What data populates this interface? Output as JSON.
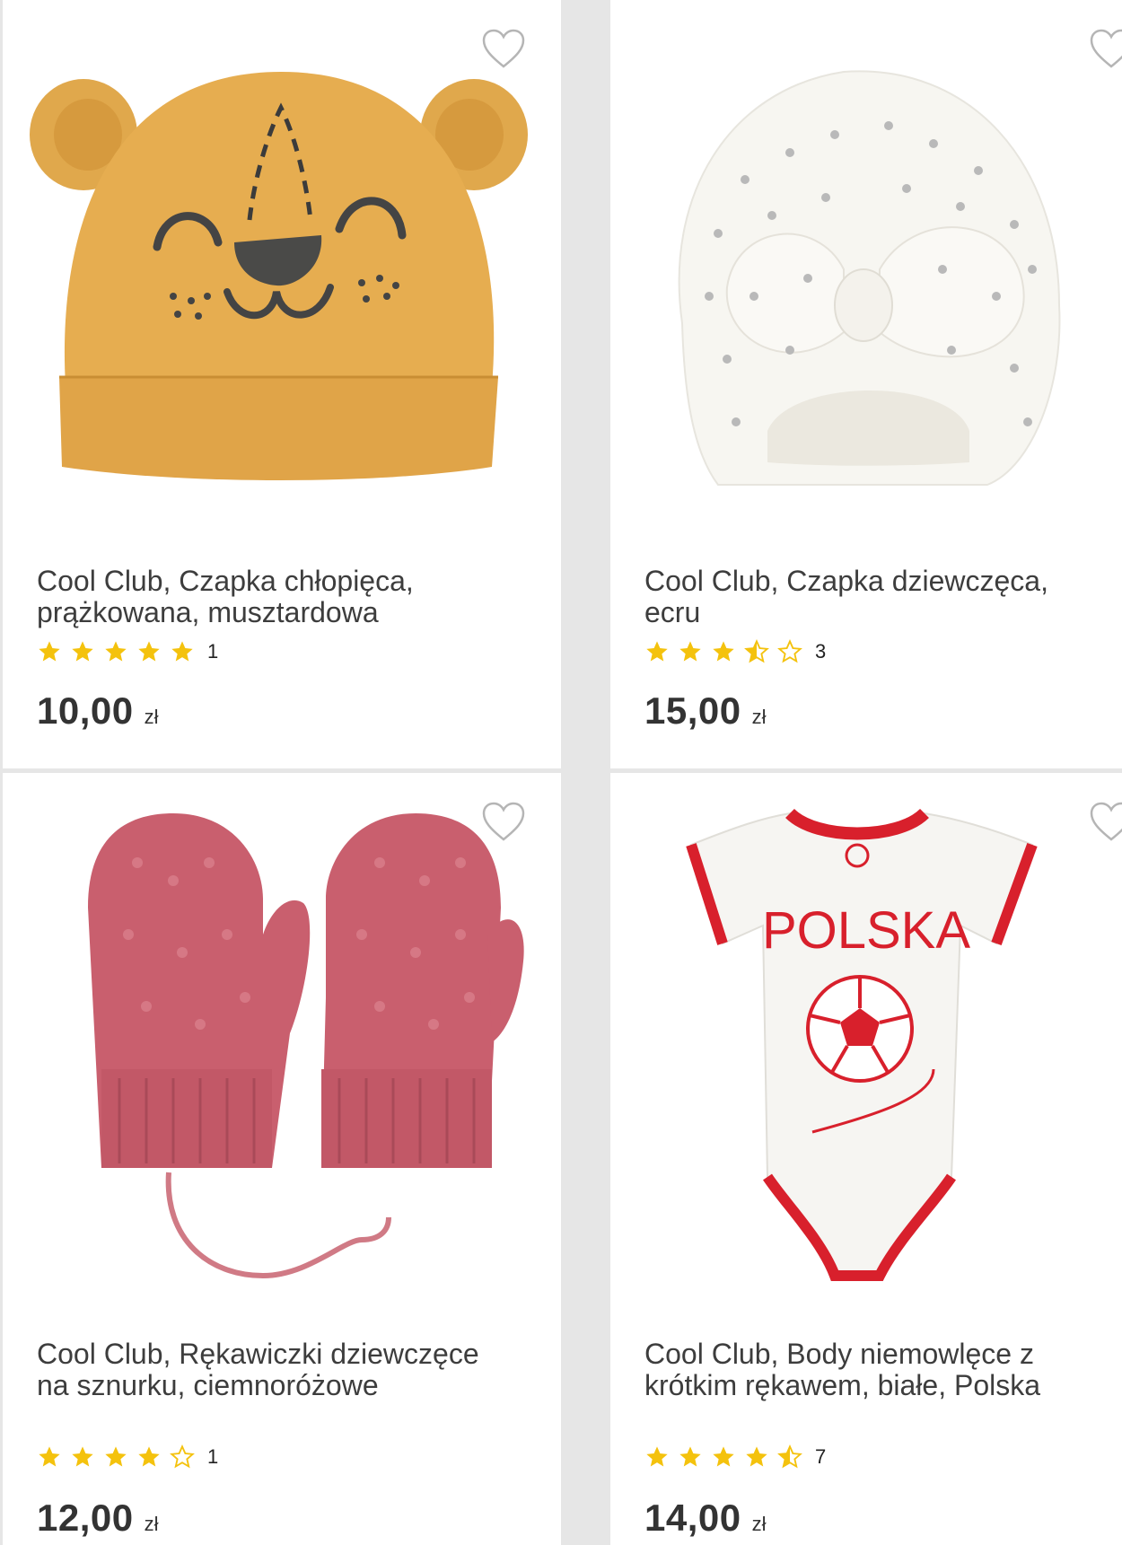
{
  "products": [
    {
      "title_line1": "Cool Club, Czapka chłopięca,",
      "title_line2": "prążkowana, musztardowa",
      "rating": 5,
      "rating_count": "1",
      "price": "10,00",
      "currency": "zł",
      "image_icon": "mustard-bear-hat-image"
    },
    {
      "title_line1": "Cool Club, Czapka dziewczęca,",
      "title_line2": "ecru",
      "rating": 3.5,
      "rating_count": "3",
      "price": "15,00",
      "currency": "zł",
      "image_icon": "white-turban-hat-image"
    },
    {
      "title_line1": "Cool Club, Rękawiczki dziewczęce",
      "title_line2": "na sznurku, ciemnoróżowe",
      "rating": 4,
      "rating_count": "1",
      "price": "12,00",
      "currency": "zł",
      "image_icon": "pink-mittens-image"
    },
    {
      "title_line1": "Cool Club, Body niemowlęce z",
      "title_line2": "krótkim rękawem, białe, Polska",
      "rating": 4.5,
      "rating_count": "7",
      "price": "14,00",
      "currency": "zł",
      "image_icon": "polska-bodysuit-image",
      "image_text": "POLSKA"
    }
  ],
  "colors": {
    "star": "#f4c20d",
    "text": "#3d3d3d",
    "background": "#e6e6e6",
    "card": "#ffffff"
  }
}
